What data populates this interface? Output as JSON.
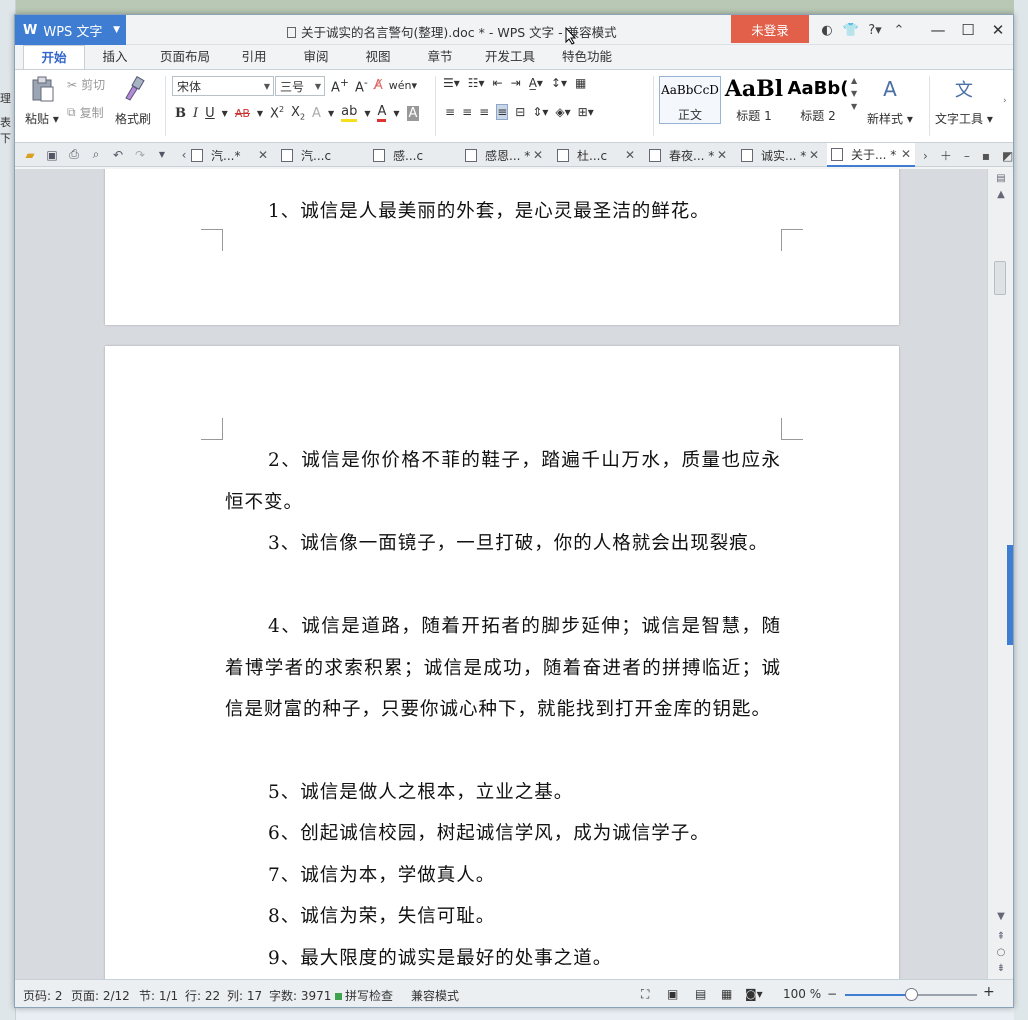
{
  "window": {
    "app_button": "WPS 文字",
    "title": "关于诚实的名言警句(整理).doc * - WPS 文字 - 兼容模式",
    "login": "未登录"
  },
  "background": {
    "left_text_1": "理",
    "left_text_2": "表下"
  },
  "ribbon_tabs": [
    "开始",
    "插入",
    "页面布局",
    "引用",
    "审阅",
    "视图",
    "章节",
    "开发工具",
    "特色功能"
  ],
  "ribbon": {
    "paste": "粘贴",
    "cut": "剪切",
    "copy": "复制",
    "format_painter": "格式刷",
    "font_name": "宋体",
    "font_size": "三号",
    "styles": [
      {
        "preview": "AaBbCcD",
        "name": "正文"
      },
      {
        "preview": "AaBl",
        "name": "标题 1"
      },
      {
        "preview": "AaBb(",
        "name": "标题 2"
      }
    ],
    "new_style": "新样式",
    "text_tools": "文字工具"
  },
  "doc_tabs": [
    {
      "label": "汽...*"
    },
    {
      "label": "汽...c"
    },
    {
      "label": "感...c"
    },
    {
      "label": "感恩... *"
    },
    {
      "label": "杜...c"
    },
    {
      "label": "春夜... *"
    },
    {
      "label": "诚实... *"
    },
    {
      "label": "关于... *"
    }
  ],
  "document": {
    "page1": [
      "1、诚信是人最美丽的外套，是心灵最圣洁的鲜花。"
    ],
    "page2": [
      "2、诚信是你价格不菲的鞋子，踏遍千山万水，质量也应永恒不变。",
      "3、诚信像一面镜子，一旦打破，你的人格就会出现裂痕。",
      "4、诚信是道路，随着开拓者的脚步延伸；诚信是智慧，随着博学者的求索积累；诚信是成功，随着奋进者的拼搏临近；诚信是财富的种子，只要你诚心种下，就能找到打开金库的钥匙。",
      "5、诚信是做人之根本，立业之基。",
      "6、创起诚信校园，树起诚信学风，成为诚信学子。",
      "7、诚信为本，学做真人。",
      "8、诚信为荣，失信可耻。",
      "9、最大限度的诚实是最好的处事之道。"
    ]
  },
  "status": {
    "page_no": "页码: 2",
    "pages": "页面: 2/12",
    "section": "节: 1/1",
    "row": "行: 22",
    "col": "列: 17",
    "words": "字数: 3971",
    "spell": "拼写检查",
    "compat": "兼容模式",
    "zoom": "100 %",
    "zoom_level": 0.5
  }
}
